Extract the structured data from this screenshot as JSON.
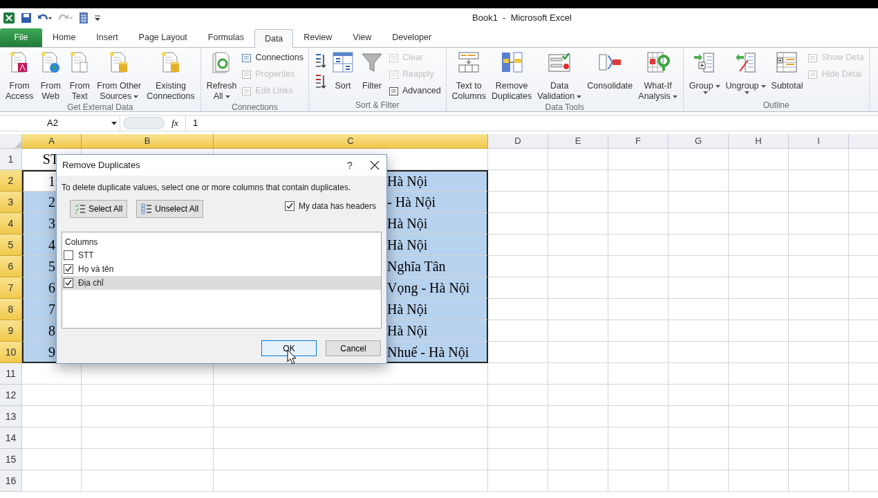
{
  "window": {
    "title": "Book1  -  Microsoft Excel"
  },
  "tabs": [
    {
      "label": "File",
      "kind": "file",
      "selected": false
    },
    {
      "label": "Home",
      "kind": "tab",
      "selected": false
    },
    {
      "label": "Insert",
      "kind": "tab",
      "selected": false
    },
    {
      "label": "Page Layout",
      "kind": "tab",
      "selected": false
    },
    {
      "label": "Formulas",
      "kind": "tab",
      "selected": false
    },
    {
      "label": "Data",
      "kind": "tab",
      "selected": true
    },
    {
      "label": "Review",
      "kind": "tab",
      "selected": false
    },
    {
      "label": "View",
      "kind": "tab",
      "selected": false
    },
    {
      "label": "Developer",
      "kind": "tab",
      "selected": false
    }
  ],
  "ribbon": [
    {
      "label": "Get External Data",
      "items": [
        {
          "kind": "large",
          "lines": [
            "From",
            "Access"
          ],
          "dropdown": false
        },
        {
          "kind": "large",
          "lines": [
            "From",
            "Web"
          ],
          "dropdown": false
        },
        {
          "kind": "large",
          "lines": [
            "From",
            "Text"
          ],
          "dropdown": false
        },
        {
          "kind": "large",
          "lines": [
            "From Other",
            "Sources"
          ],
          "dropdown": true
        },
        {
          "kind": "large",
          "lines": [
            "Existing",
            "Connections"
          ],
          "dropdown": false
        }
      ]
    },
    {
      "label": "Connections",
      "items": [
        {
          "kind": "large",
          "lines": [
            "Refresh",
            "All"
          ],
          "dropdown": true
        },
        {
          "kind": "stack",
          "items": [
            {
              "label": "Connections",
              "disabled": false
            },
            {
              "label": "Properties",
              "disabled": true
            },
            {
              "label": "Edit Links",
              "disabled": true
            }
          ]
        }
      ]
    },
    {
      "label": "Sort & Filter",
      "items": [
        {
          "kind": "iconstack",
          "items": [
            {
              "disabled": false
            },
            {
              "disabled": false
            }
          ]
        },
        {
          "kind": "large",
          "lines": [
            "Sort"
          ],
          "dropdown": false
        },
        {
          "kind": "large",
          "lines": [
            "Filter"
          ],
          "dropdown": false
        },
        {
          "kind": "stack",
          "items": [
            {
              "label": "Clear",
              "disabled": true
            },
            {
              "label": "Reapply",
              "disabled": true
            },
            {
              "label": "Advanced",
              "disabled": false
            }
          ]
        }
      ]
    },
    {
      "label": "Data Tools",
      "items": [
        {
          "kind": "large",
          "lines": [
            "Text to",
            "Columns"
          ],
          "dropdown": false
        },
        {
          "kind": "large",
          "lines": [
            "Remove",
            "Duplicates"
          ],
          "dropdown": false
        },
        {
          "kind": "large",
          "lines": [
            "Data",
            "Validation"
          ],
          "dropdown": true
        },
        {
          "kind": "large",
          "lines": [
            "Consolidate"
          ],
          "dropdown": false
        },
        {
          "kind": "large",
          "lines": [
            "What-If",
            "Analysis"
          ],
          "dropdown": true
        }
      ]
    },
    {
      "label": "Outline",
      "items": [
        {
          "kind": "large",
          "lines": [
            "Group"
          ],
          "dropdown": true
        },
        {
          "kind": "large",
          "lines": [
            "Ungroup"
          ],
          "dropdown": true
        },
        {
          "kind": "large",
          "lines": [
            "Subtotal"
          ],
          "dropdown": false
        },
        {
          "kind": "stack",
          "items": [
            {
              "label": "Show Deta",
              "disabled": true
            },
            {
              "label": "Hide Detai",
              "disabled": true
            }
          ]
        }
      ]
    }
  ],
  "formula_bar": {
    "name_box": "A2",
    "fx": "fx",
    "value": "1"
  },
  "sheet": {
    "columns": [
      {
        "label": "A",
        "selected": true
      },
      {
        "label": "B",
        "selected": true
      },
      {
        "label": "C",
        "selected": true
      },
      {
        "label": "D",
        "selected": false
      },
      {
        "label": "E",
        "selected": false
      },
      {
        "label": "F",
        "selected": false
      },
      {
        "label": "G",
        "selected": false
      },
      {
        "label": "H",
        "selected": false
      },
      {
        "label": "I",
        "selected": false
      }
    ],
    "rows": [
      {
        "number": "1",
        "selected": false,
        "a": "ST"
      },
      {
        "number": "2",
        "selected": true,
        "active": true,
        "a": "1",
        "c": "Hà Nội"
      },
      {
        "number": "3",
        "selected": true,
        "active": false,
        "a": "2",
        "c": "- Hà Nội"
      },
      {
        "number": "4",
        "selected": true,
        "active": false,
        "a": "3",
        "c": "Hà Nội"
      },
      {
        "number": "5",
        "selected": true,
        "active": false,
        "a": "4",
        "c": "Hà Nội"
      },
      {
        "number": "6",
        "selected": true,
        "active": false,
        "a": "5",
        "c": "Nghĩa Tân"
      },
      {
        "number": "7",
        "selected": true,
        "active": false,
        "a": "6",
        "c": "Vọng - Hà Nội"
      },
      {
        "number": "8",
        "selected": true,
        "active": false,
        "a": "7",
        "c": "Hà Nội"
      },
      {
        "number": "9",
        "selected": true,
        "active": false,
        "a": "8",
        "c": "Hà Nội"
      },
      {
        "number": "10",
        "selected": true,
        "active": false,
        "a": "9",
        "c": "Nhuế - Hà Nội"
      },
      {
        "number": "11",
        "selected": false
      },
      {
        "number": "12",
        "selected": false
      },
      {
        "number": "13",
        "selected": false
      },
      {
        "number": "14",
        "selected": false
      },
      {
        "number": "15",
        "selected": false
      },
      {
        "number": "16",
        "selected": false
      }
    ]
  },
  "dialog": {
    "title": "Remove Duplicates",
    "help": "?",
    "instruction": "To delete duplicate values, select one or more columns that contain duplicates.",
    "select_all": "Select All",
    "unselect_all": "Unselect All",
    "headers_checkbox": {
      "label": "My data has headers",
      "checked": true
    },
    "columns_label": "Columns",
    "columns": [
      {
        "label": "STT",
        "checked": false,
        "selected": false
      },
      {
        "label": "Họ và tên",
        "checked": true,
        "selected": false
      },
      {
        "label": "Địa chỉ",
        "checked": true,
        "selected": true
      }
    ],
    "ok": "OK",
    "cancel": "Cancel"
  }
}
